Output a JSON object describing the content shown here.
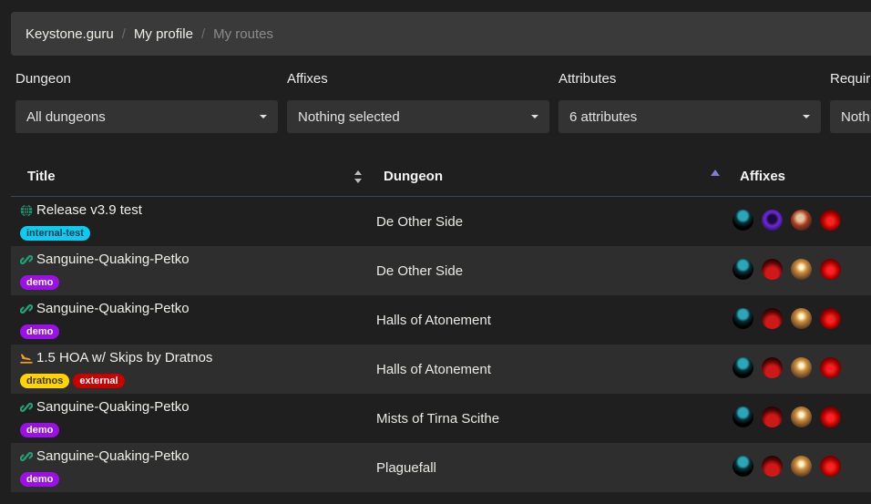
{
  "breadcrumb": {
    "items": [
      {
        "label": "Keystone.guru",
        "active": false
      },
      {
        "label": "My profile",
        "active": false
      },
      {
        "label": "My routes",
        "active": true
      }
    ],
    "separator": "/"
  },
  "filters": [
    {
      "label": "Dungeon",
      "value": "All dungeons"
    },
    {
      "label": "Affixes",
      "value": "Nothing selected"
    },
    {
      "label": "Attributes",
      "value": "6 attributes"
    },
    {
      "label": "Requir",
      "value": "Noth"
    }
  ],
  "table": {
    "columns": [
      {
        "label": "Title",
        "sort": "both"
      },
      {
        "label": "Dungeon",
        "sort": "asc"
      },
      {
        "label": "Affixes"
      }
    ],
    "rows": [
      {
        "icon": "globe-icon",
        "title": "Release v3.9 test",
        "tags": [
          {
            "label": "internal-test",
            "bg": "#0dcaf0",
            "fg": "#0e3a44"
          }
        ],
        "dungeon": "De Other Side",
        "affixes": [
          "tyrannical",
          "spiteful",
          "inspiring",
          "prideful"
        ]
      },
      {
        "icon": "link-icon",
        "title": "Sanguine-Quaking-Petko",
        "tags": [
          {
            "label": "demo",
            "bg": "#9a10e6",
            "fg": "#ffffff"
          }
        ],
        "dungeon": "De Other Side",
        "affixes": [
          "tyrannical",
          "sanguine",
          "bolstering",
          "prideful"
        ]
      },
      {
        "icon": "link-icon",
        "title": "Sanguine-Quaking-Petko",
        "tags": [
          {
            "label": "demo",
            "bg": "#9a10e6",
            "fg": "#ffffff"
          }
        ],
        "dungeon": "Halls of Atonement",
        "affixes": [
          "tyrannical",
          "sanguine",
          "bolstering",
          "prideful"
        ]
      },
      {
        "icon": "plane-landing-icon",
        "title": "1.5 HOA w/ Skips by Dratnos",
        "tags": [
          {
            "label": "dratnos",
            "bg": "#ffd400",
            "fg": "#3a3200"
          },
          {
            "label": "external",
            "bg": "#c80000",
            "fg": "#ffffff"
          }
        ],
        "dungeon": "Halls of Atonement",
        "affixes": [
          "tyrannical",
          "sanguine",
          "bolstering",
          "prideful"
        ]
      },
      {
        "icon": "link-icon",
        "title": "Sanguine-Quaking-Petko",
        "tags": [
          {
            "label": "demo",
            "bg": "#9a10e6",
            "fg": "#ffffff"
          }
        ],
        "dungeon": "Mists of Tirna Scithe",
        "affixes": [
          "tyrannical",
          "sanguine",
          "bolstering",
          "prideful"
        ]
      },
      {
        "icon": "link-icon",
        "title": "Sanguine-Quaking-Petko",
        "tags": [
          {
            "label": "demo",
            "bg": "#9a10e6",
            "fg": "#ffffff"
          }
        ],
        "dungeon": "Plaguefall",
        "affixes": [
          "tyrannical",
          "sanguine",
          "bolstering",
          "prideful"
        ]
      }
    ]
  },
  "colors": {
    "background": "#1f1f1f",
    "breadcrumb_bg": "#3a3a3a",
    "select_bg": "#333333",
    "row_alt_bg": "#2e2e2e",
    "icon_green": "#22a07a",
    "icon_orange": "#f0a020",
    "sort_active": "#7f7bd6"
  }
}
